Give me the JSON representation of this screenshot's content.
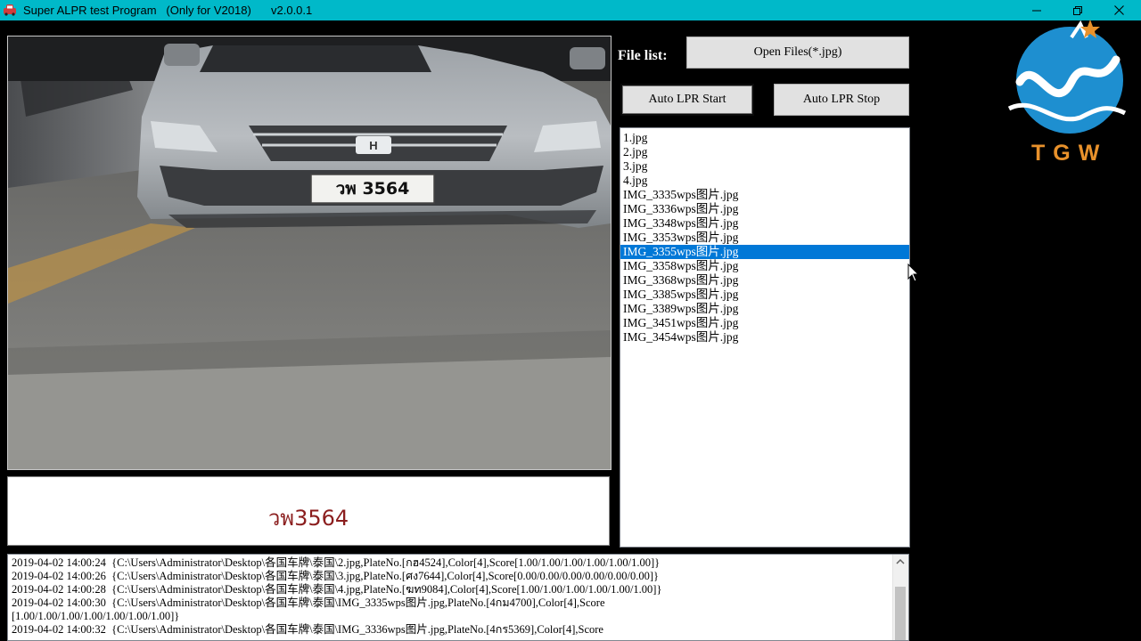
{
  "window": {
    "title": "Super ALPR test Program   (Only for V2018)",
    "version": "v2.0.0.1",
    "controls": [
      "minimize-icon",
      "restore-icon",
      "close-icon"
    ]
  },
  "photo": {
    "plate_text": "วพ 3564",
    "badge": "HONDA"
  },
  "result": {
    "plate": "วพ3564",
    "color": "#8b1e1e"
  },
  "controls": {
    "file_list_label": "File list:",
    "open_files": "Open Files(*.jpg)",
    "auto_start": "Auto LPR Start",
    "auto_stop": "Auto LPR Stop"
  },
  "file_list": {
    "selected_index": 8,
    "items": [
      "1.jpg",
      "2.jpg",
      "3.jpg",
      "4.jpg",
      "IMG_3335wps图片.jpg",
      "IMG_3336wps图片.jpg",
      "IMG_3348wps图片.jpg",
      "IMG_3353wps图片.jpg",
      "IMG_3355wps图片.jpg",
      "IMG_3358wps图片.jpg",
      "IMG_3368wps图片.jpg",
      "IMG_3385wps图片.jpg",
      "IMG_3389wps图片.jpg",
      "IMG_3451wps图片.jpg",
      "IMG_3454wps图片.jpg"
    ]
  },
  "log": {
    "lines": [
      "2019-04-02 14:00:24  {C:\\Users\\Administrator\\Desktop\\各国车牌\\泰国\\2.jpg,PlateNo.[กฮ4524],Color[4],Score[1.00/1.00/1.00/1.00/1.00/1.00]}",
      "2019-04-02 14:00:26  {C:\\Users\\Administrator\\Desktop\\各国车牌\\泰国\\3.jpg,PlateNo.[ศง7644],Color[4],Score[0.00/0.00/0.00/0.00/0.00/0.00]}",
      "2019-04-02 14:00:28  {C:\\Users\\Administrator\\Desktop\\各国车牌\\泰国\\4.jpg,PlateNo.[ฆท9084],Color[4],Score[1.00/1.00/1.00/1.00/1.00/1.00]}",
      "2019-04-02 14:00:30  {C:\\Users\\Administrator\\Desktop\\各国车牌\\泰国\\IMG_3335wps图片.jpg,PlateNo.[4กม4700],Color[4],Score",
      "[1.00/1.00/1.00/1.00/1.00/1.00/1.00]}",
      "2019-04-02 14:00:32  {C:\\Users\\Administrator\\Desktop\\各国车牌\\泰国\\IMG_3336wps图片.jpg,PlateNo.[4กร5369],Color[4],Score"
    ]
  },
  "logo": {
    "text": "TGW",
    "colors": {
      "blue": "#1e8fd0",
      "orange": "#e8912b"
    }
  },
  "colors": {
    "titlebar": "#00b9c9",
    "selection": "#0078d7"
  }
}
